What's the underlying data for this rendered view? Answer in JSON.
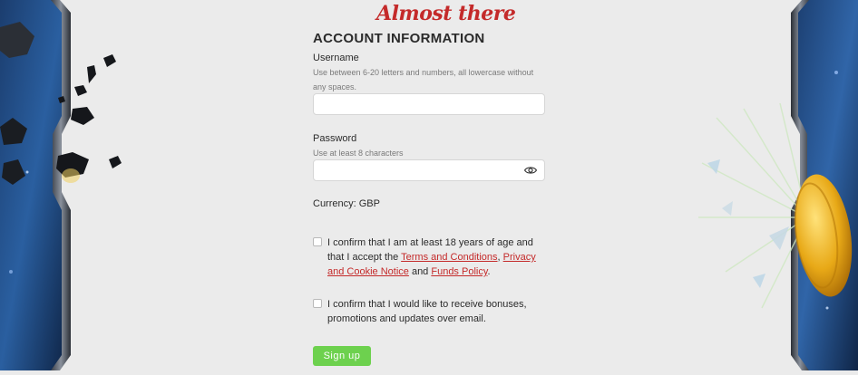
{
  "header": {
    "title": "Almost there"
  },
  "section": {
    "heading": "ACCOUNT INFORMATION"
  },
  "username": {
    "label": "Username",
    "hint": "Use between 6-20 letters and numbers, all lowercase without any spaces.",
    "value": "",
    "placeholder": ""
  },
  "password": {
    "label": "Password",
    "hint": "Use at least 8 characters",
    "value": "",
    "placeholder": "",
    "toggle_icon": "eye-icon"
  },
  "currency": {
    "text": "Currency: GBP"
  },
  "age_consent": {
    "text_before": "I confirm that I am at least 18 years of age and that I accept the ",
    "link_terms": "Terms and Conditions",
    "sep1": ", ",
    "link_privacy": "Privacy and Cookie Notice",
    "sep2": " and ",
    "link_funds": "Funds Policy",
    "text_after": ".",
    "checked": false
  },
  "marketing_consent": {
    "text": "I confirm that I would like to receive bonuses, promotions and updates over email.",
    "checked": false
  },
  "signup": {
    "label": "Sign up"
  },
  "colors": {
    "accent": "#c42a2a",
    "button": "#6dd14e",
    "background": "#ebebeb"
  }
}
